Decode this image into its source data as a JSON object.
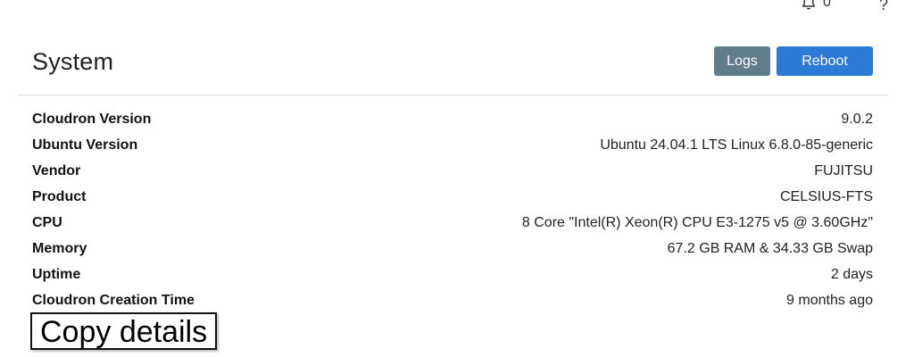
{
  "topbar": {
    "notification_count": "0",
    "help_label": "?"
  },
  "header": {
    "title": "System",
    "logs_label": "Logs",
    "reboot_label": "Reboot"
  },
  "info": {
    "rows": [
      {
        "label": "Cloudron Version",
        "value": "9.0.2"
      },
      {
        "label": "Ubuntu Version",
        "value": "Ubuntu 24.04.1 LTS Linux 6.8.0-85-generic"
      },
      {
        "label": "Vendor",
        "value": "FUJITSU"
      },
      {
        "label": "Product",
        "value": "CELSIUS-FTS"
      },
      {
        "label": "CPU",
        "value": "8 Core \"Intel(R) Xeon(R) CPU E3-1275 v5 @ 3.60GHz\""
      },
      {
        "label": "Memory",
        "value": "67.2 GB RAM & 34.33 GB Swap"
      },
      {
        "label": "Uptime",
        "value": "2 days"
      },
      {
        "label": "Cloudron Creation Time",
        "value": "9 months ago"
      }
    ]
  },
  "copy_label": "Copy details",
  "colors": {
    "logs_button": "#607d8b",
    "reboot_button": "#2c7ad6"
  },
  "icons": {
    "notification": "bell-icon",
    "help": "question-mark-icon"
  }
}
